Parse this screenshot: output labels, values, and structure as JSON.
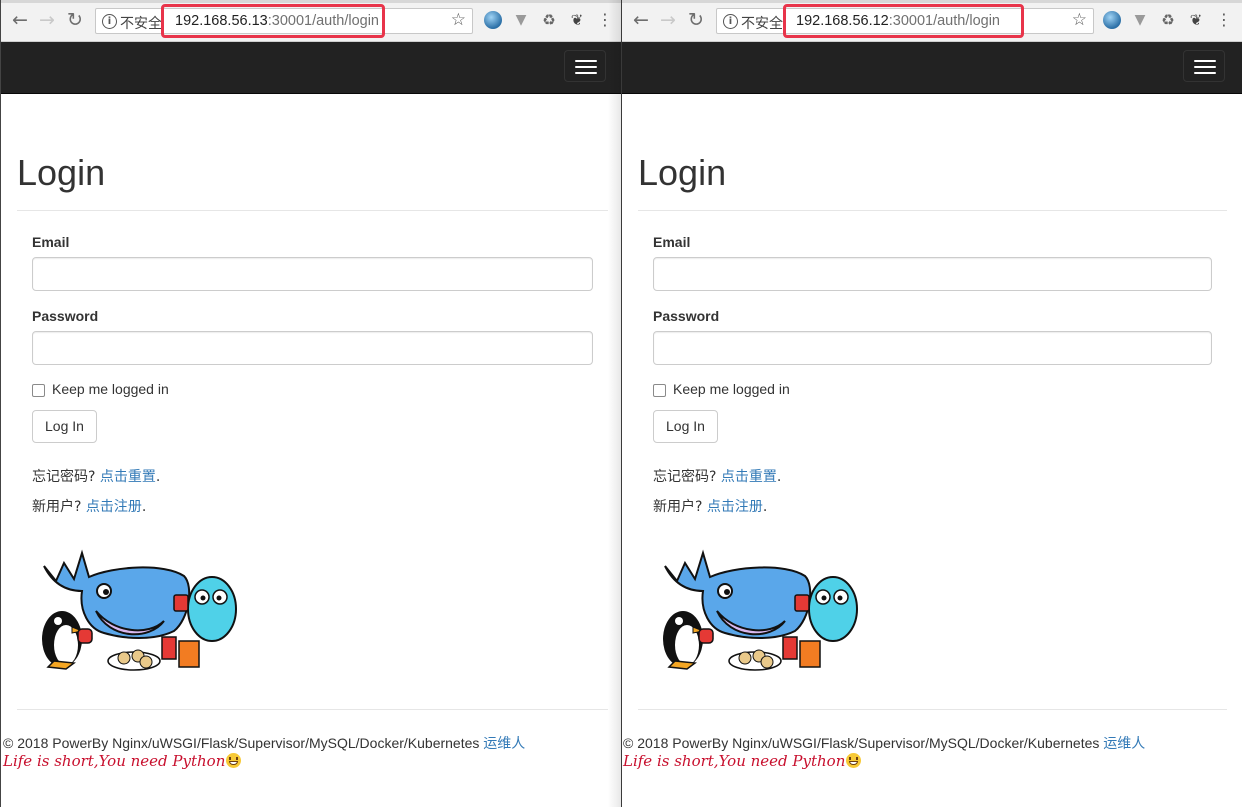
{
  "security_label": "不安全",
  "url_host_1": "192.168.56.13",
  "url_host_2": "192.168.56.12",
  "url_path": ":30001/auth/login",
  "login_title": "Login",
  "email_label": "Email",
  "password_label": "Password",
  "remember_label": "Keep me logged in",
  "login_button": "Log In",
  "forgot_prefix": "忘记密码? ",
  "forgot_link": "点击重置",
  "new_user_prefix": "新用户? ",
  "register_link": "点击注册",
  "period": ".",
  "footer_text": "© 2018 PowerBy Nginx/uWSGI/Flask/Supervisor/MySQL/Docker/Kubernetes ",
  "footer_link": "运维人",
  "slogan": "Life is short,You need Python",
  "colors": {
    "navbar": "#222222",
    "link": "#337ab7",
    "highlight": "#e8344a",
    "slogan": "#c8102e"
  },
  "icons": [
    "back-icon",
    "forward-icon",
    "reload-icon",
    "info-icon",
    "star-icon",
    "globe-extension-icon",
    "vue-extension-icon",
    "recycle-extension-icon",
    "evernote-extension-icon",
    "menu-dots-icon",
    "hamburger-icon",
    "docker-go-penguin-illustration"
  ]
}
